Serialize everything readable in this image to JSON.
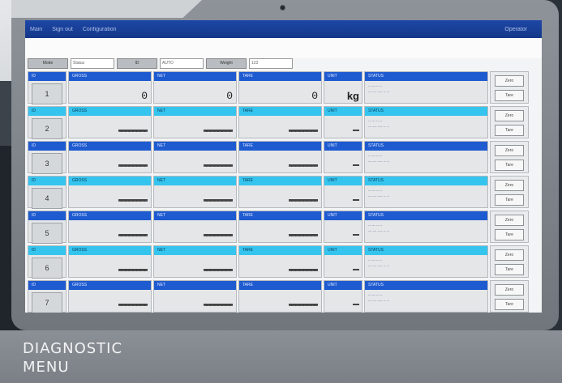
{
  "menubar": {
    "items": [
      "Main",
      "Sign out",
      "Configuration"
    ],
    "right": "Operator"
  },
  "statusbar": [
    {
      "label": "Mode",
      "value": "Status"
    },
    {
      "label": "ID",
      "value": "AUTO"
    },
    {
      "label": "Weight",
      "value": "123"
    }
  ],
  "rows": [
    {
      "id": "1",
      "header_id": "ID",
      "gross_label": "GROSS",
      "gross": "0",
      "net_label": "NET",
      "net": "0",
      "tare_label": "TARE",
      "tare": "0",
      "unit_label": "UNIT",
      "unit": "kg",
      "status_label": "STATUS",
      "status_l1": "-- --- -- --",
      "status_l2": "--- --- ---- -- --",
      "btn1": "Zero",
      "btn2": "Tare",
      "style": "blue"
    },
    {
      "id": "2",
      "header_id": "ID",
      "gross_label": "GROSS",
      "gross": "",
      "net_label": "NET",
      "net": "",
      "tare_label": "TARE",
      "tare": "",
      "unit_label": "UNIT",
      "unit": "",
      "status_label": "STATUS",
      "status_l1": "-- --- -- --",
      "status_l2": "--- --- ---- -- --",
      "btn1": "Zero",
      "btn2": "Tare",
      "style": "cyan"
    },
    {
      "id": "3",
      "header_id": "ID",
      "gross_label": "GROSS",
      "gross": "",
      "net_label": "NET",
      "net": "",
      "tare_label": "TARE",
      "tare": "",
      "unit_label": "UNIT",
      "unit": "",
      "status_label": "STATUS",
      "status_l1": "-- --- -- --",
      "status_l2": "--- --- ---- -- --",
      "btn1": "Zero",
      "btn2": "Tare",
      "style": "blue"
    },
    {
      "id": "4",
      "header_id": "ID",
      "gross_label": "GROSS",
      "gross": "",
      "net_label": "NET",
      "net": "",
      "tare_label": "TARE",
      "tare": "",
      "unit_label": "UNIT",
      "unit": "",
      "status_label": "STATUS",
      "status_l1": "-- --- -- --",
      "status_l2": "--- --- ---- -- --",
      "btn1": "Zero",
      "btn2": "Tare",
      "style": "cyan"
    },
    {
      "id": "5",
      "header_id": "ID",
      "gross_label": "GROSS",
      "gross": "",
      "net_label": "NET",
      "net": "",
      "tare_label": "TARE",
      "tare": "",
      "unit_label": "UNIT",
      "unit": "",
      "status_label": "STATUS",
      "status_l1": "-- --- -- --",
      "status_l2": "--- --- ---- -- --",
      "btn1": "Zero",
      "btn2": "Tare",
      "style": "blue"
    },
    {
      "id": "6",
      "header_id": "ID",
      "gross_label": "GROSS",
      "gross": "",
      "net_label": "NET",
      "net": "",
      "tare_label": "TARE",
      "tare": "",
      "unit_label": "UNIT",
      "unit": "",
      "status_label": "STATUS",
      "status_l1": "-- --- -- --",
      "status_l2": "--- --- ---- -- --",
      "btn1": "Zero",
      "btn2": "Tare",
      "style": "cyan"
    },
    {
      "id": "7",
      "header_id": "ID",
      "gross_label": "GROSS",
      "gross": "",
      "net_label": "NET",
      "net": "",
      "tare_label": "TARE",
      "tare": "",
      "unit_label": "UNIT",
      "unit": "",
      "status_label": "STATUS",
      "status_l1": "-- --- -- --",
      "status_l2": "--- --- ---- -- --",
      "btn1": "Zero",
      "btn2": "Tare",
      "style": "blue"
    }
  ],
  "caption": {
    "line1": "DIAGNOSTIC",
    "line2": "MENU"
  },
  "colors": {
    "header_blue": "#1f5bd0",
    "header_cyan": "#35c4ee",
    "menubar": "#1d47a6",
    "caption_bg": "#8b9096"
  }
}
